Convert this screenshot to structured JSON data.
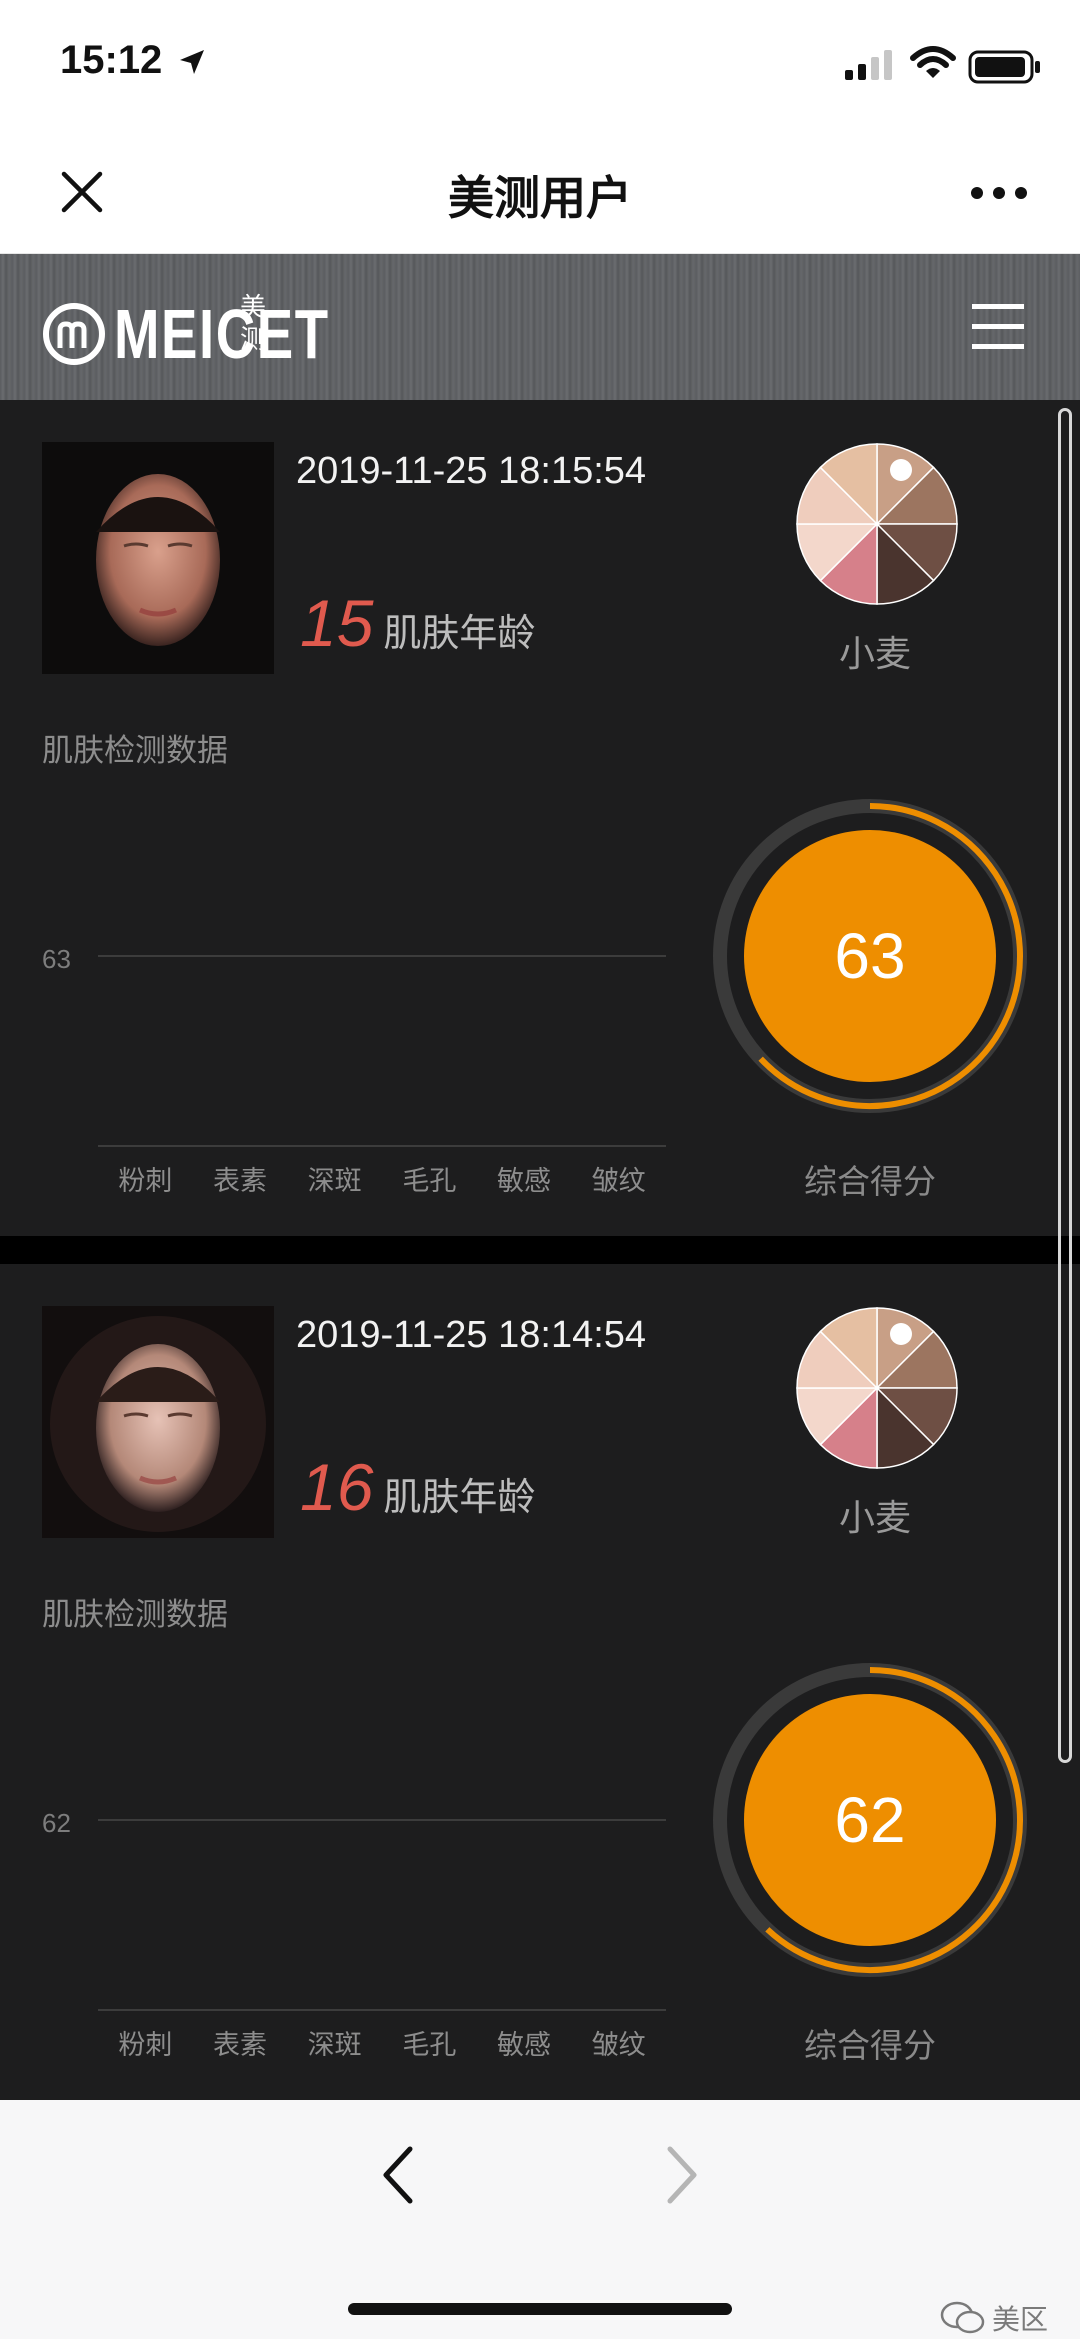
{
  "status_bar": {
    "time": "15:12"
  },
  "nav": {
    "title": "美测用户"
  },
  "brand": {
    "name": "MEICET",
    "cn_top": "美",
    "cn_bottom": "测"
  },
  "cards": [
    {
      "time": "2019-11-25 18:15:54",
      "age": "15",
      "age_label": "肌肤年龄",
      "tone": "小麦",
      "section_title": "肌肤检测数据",
      "chart_data": {
        "type": "line",
        "y_reference_label": "63",
        "categories": [
          "粉刺",
          "表素",
          "深斑",
          "毛孔",
          "敏感",
          "皱纹"
        ]
      },
      "score": "63",
      "score_fraction": 0.63,
      "score_label": "综合得分"
    },
    {
      "time": "2019-11-25 18:14:54",
      "age": "16",
      "age_label": "肌肤年龄",
      "tone": "小麦",
      "section_title": "肌肤检测数据",
      "chart_data": {
        "type": "line",
        "y_reference_label": "62",
        "categories": [
          "粉刺",
          "表素",
          "深斑",
          "毛孔",
          "敏感",
          "皱纹"
        ]
      },
      "score": "62",
      "score_fraction": 0.62,
      "score_label": "综合得分"
    }
  ],
  "colors": {
    "score": "#ee8e00",
    "age": "#e05a4e",
    "ring_track": "#3a3a3a"
  },
  "watermark": "美区"
}
